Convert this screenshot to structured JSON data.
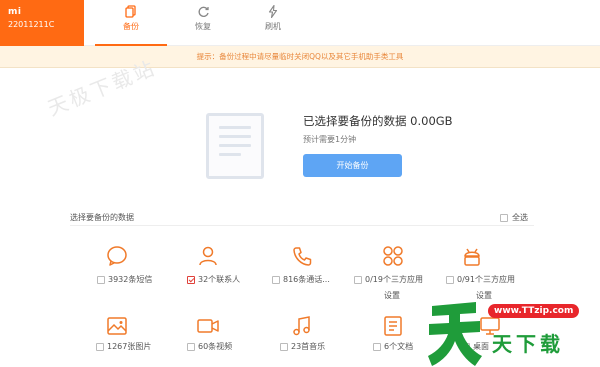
{
  "brand": {
    "logo": "mi",
    "device": "22011211C"
  },
  "tabs": [
    {
      "label": "备份",
      "icon": "backup-icon",
      "active": true
    },
    {
      "label": "恢复",
      "icon": "restore-icon",
      "active": false
    },
    {
      "label": "刷机",
      "icon": "flash-icon",
      "active": false
    }
  ],
  "notice": "提示：备份过程中请尽量临时关闭QQ以及其它手机助手类工具",
  "watermark": "天极下载站",
  "summary": {
    "title": "已选择要备份的数据 0.00GB",
    "subtitle": "预计需要1分钟",
    "start_label": "开始备份"
  },
  "select": {
    "label": "选择要备份的数据",
    "select_all": "全选"
  },
  "categories": [
    {
      "label": "3932条短信",
      "icon": "message-icon",
      "checked": false
    },
    {
      "label": "32个联系人",
      "icon": "contact-icon",
      "checked": true
    },
    {
      "label": "816条通话...",
      "icon": "phone-icon",
      "checked": false
    },
    {
      "label": "0/19个三方应用",
      "icon": "apps-icon",
      "checked": false,
      "settings": "设置"
    },
    {
      "label": "0/91个三方应用",
      "icon": "android-icon",
      "checked": false,
      "settings": "设置"
    },
    {
      "label": "1267张图片",
      "icon": "image-icon",
      "checked": false
    },
    {
      "label": "60条视频",
      "icon": "video-icon",
      "checked": false
    },
    {
      "label": "23首音乐",
      "icon": "music-icon",
      "checked": false
    },
    {
      "label": "6个文档",
      "icon": "document-icon",
      "checked": false
    },
    {
      "label": "桌面",
      "icon": "desktop-icon",
      "checked": false
    }
  ],
  "site_logo": {
    "url": "www.TTzip.com",
    "name": "天下载"
  },
  "colors": {
    "accent": "#ff6a13",
    "primary_button": "#5ea5f4",
    "notice_bg": "#fff4e2",
    "notice_text": "#e8863a",
    "checked": "#e0413a"
  }
}
